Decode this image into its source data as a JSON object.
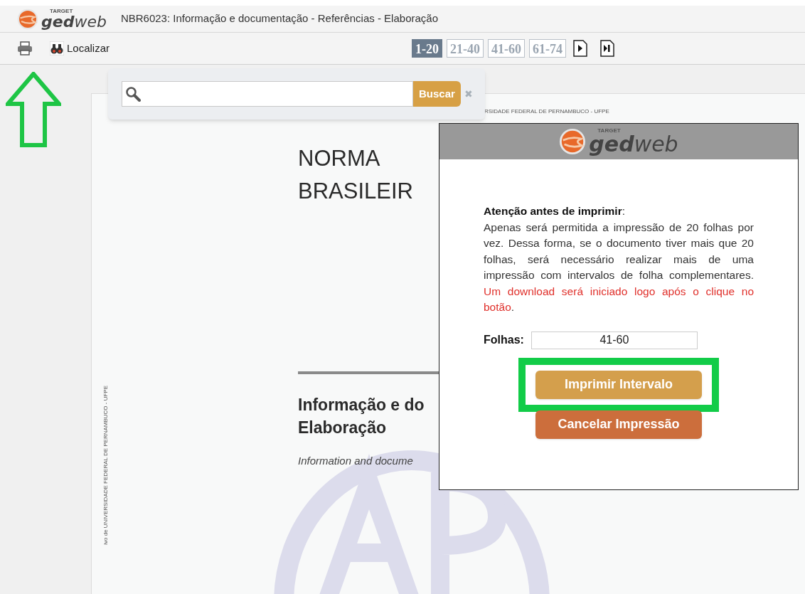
{
  "header": {
    "logo_small": "TARGET",
    "logo_text": "gedweb",
    "title": "NBR6023: Informação e documentação - Referências - Elaboração"
  },
  "toolbar": {
    "find_label": "Localizar",
    "pages": [
      {
        "label": "1-20",
        "selected": true
      },
      {
        "label": "21-40",
        "selected": false
      },
      {
        "label": "41-60",
        "selected": false
      },
      {
        "label": "61-74",
        "selected": false
      }
    ]
  },
  "search": {
    "button": "Buscar",
    "close": "✖"
  },
  "document": {
    "running_head": "RSIDADE FEDERAL DE PERNAMBUCO - UFPE",
    "side_note": "ivo de UNIVERSIDADE FEDERAL DE PERNAMBUCO - UFPE",
    "title_lines": [
      "NORMA",
      "BRASILEIR"
    ],
    "subject_lines": [
      "Informação e do",
      "Elaboração"
    ],
    "english": "Information and docume"
  },
  "dialog": {
    "logo_small": "TARGET",
    "logo_text": "gedweb",
    "heading": "Atenção antes de imprimir",
    "heading_suffix": ":",
    "message": "Apenas será permitida a impressão de 20 folhas por vez. Dessa forma, se o documento tiver mais que 20 folhas, será necessário realizar mais de uma impressão com intervalos de folha complementares.",
    "warning": "Um download será iniciado logo após o clique no botão",
    "warning_suffix": ".",
    "sheets_label": "Folhas:",
    "sheets_value": "41-60",
    "buttons": [
      {
        "label": "Imprimir Intervalo",
        "kind": "primary",
        "highlighted": true
      },
      {
        "label": "Cancelar Impressão",
        "kind": "cancel",
        "highlighted": false
      }
    ]
  }
}
